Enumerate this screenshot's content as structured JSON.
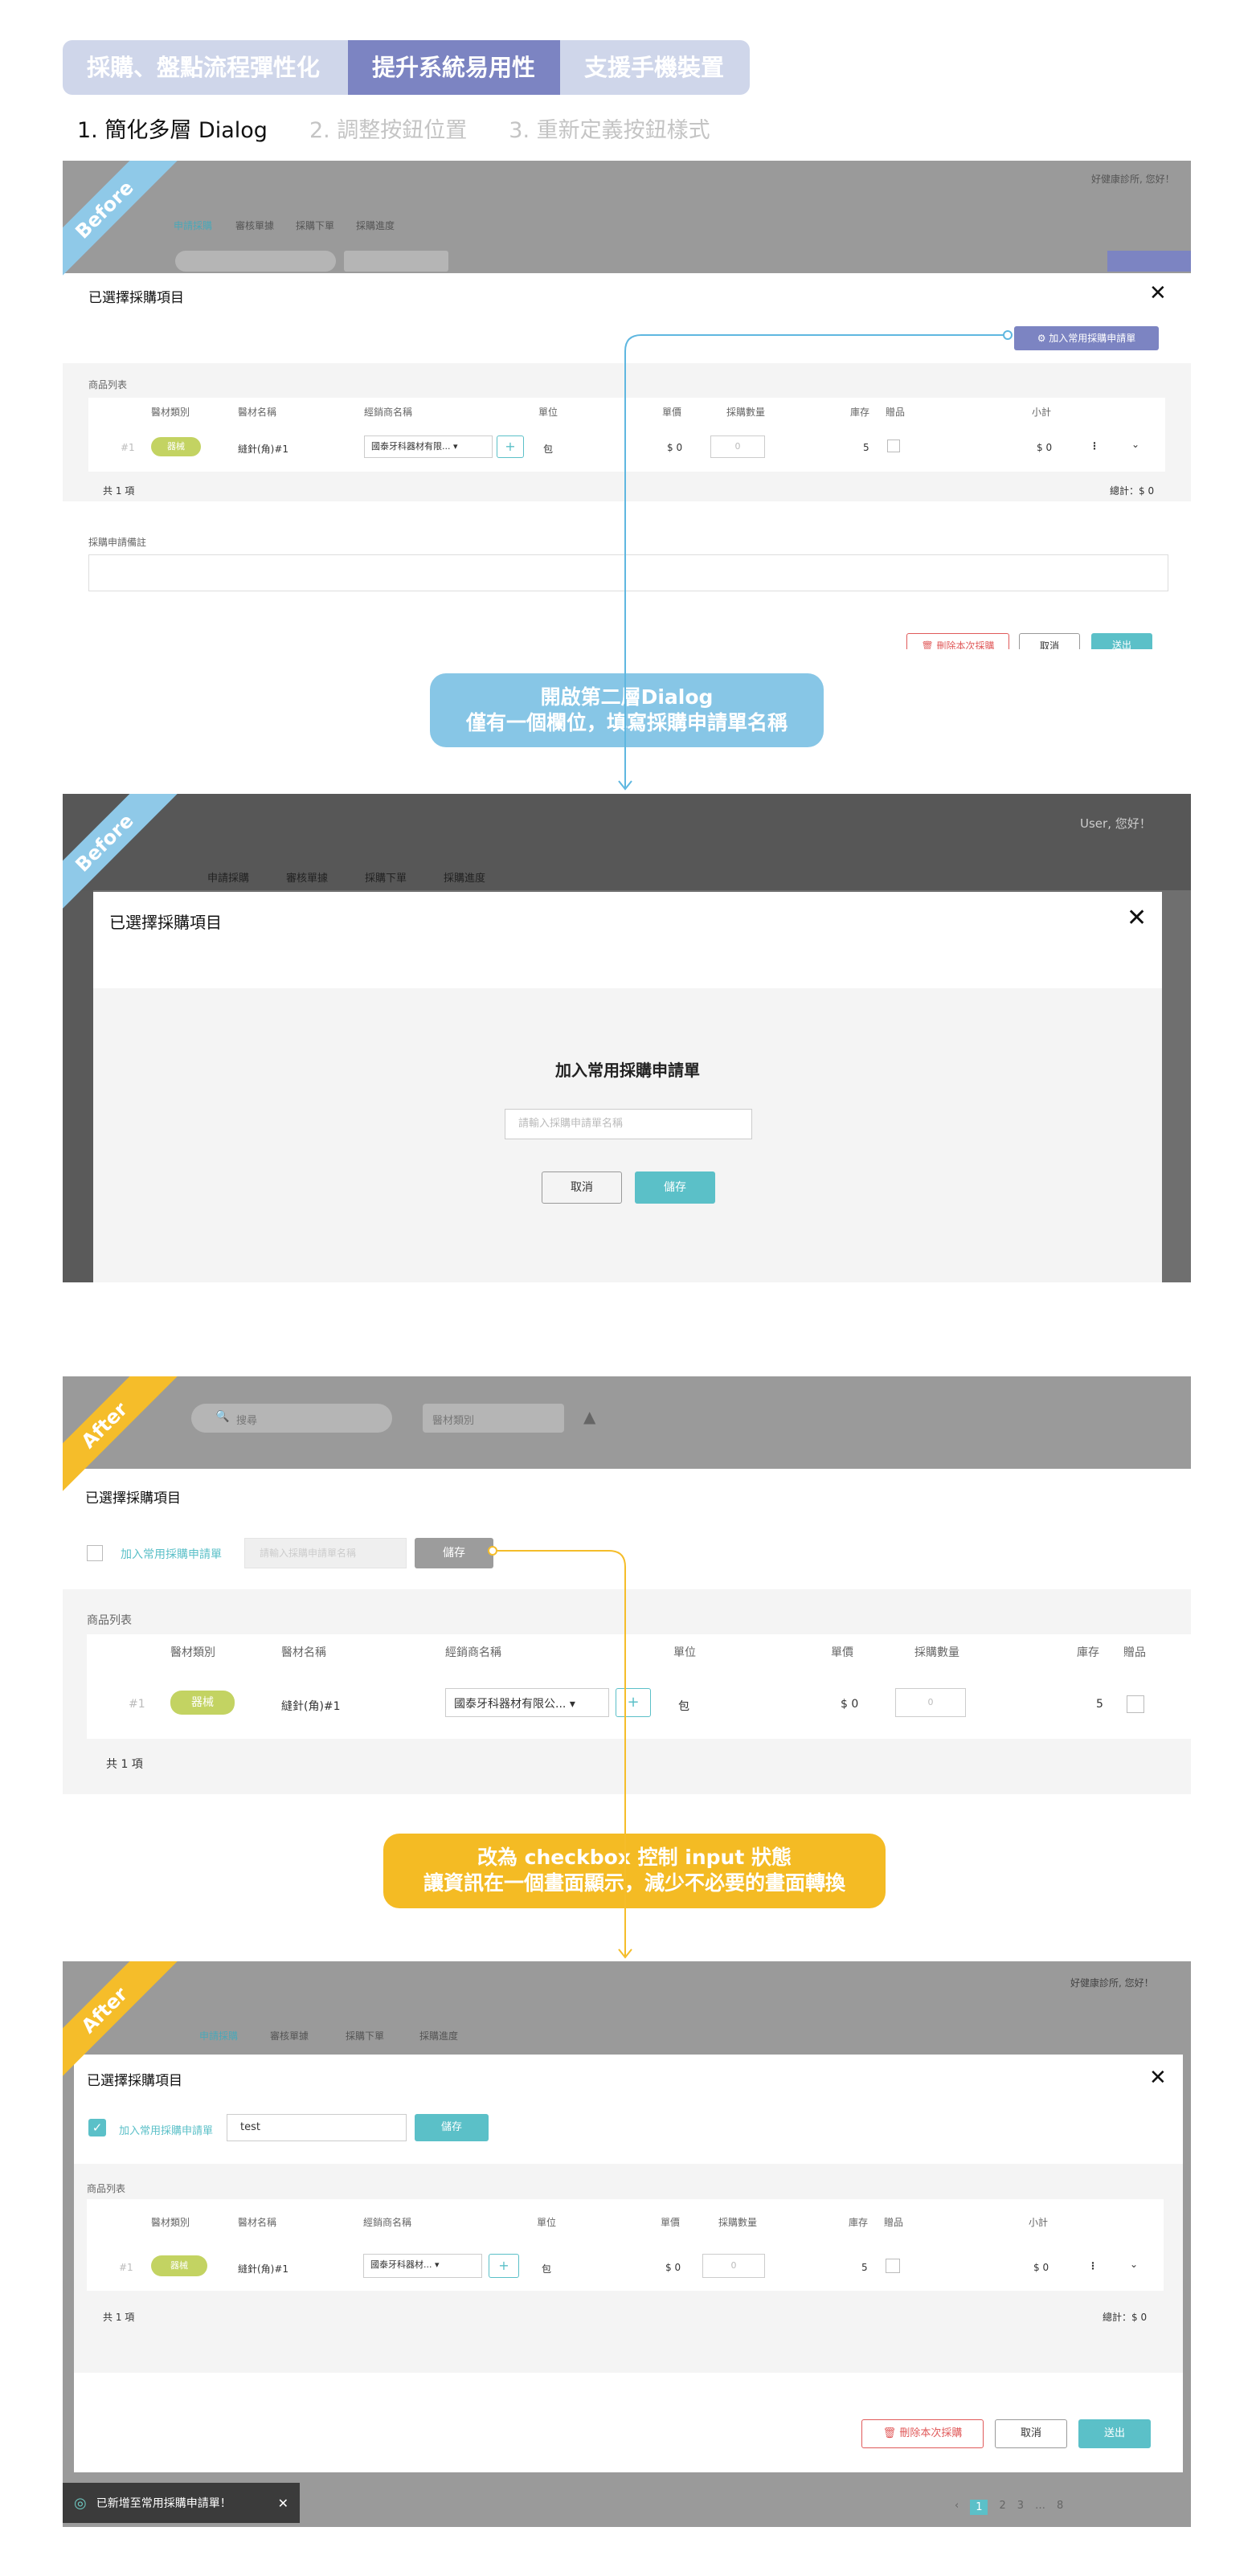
{
  "tabs": [
    {
      "label": "採購、盤點流程彈性化"
    },
    {
      "label": "提升系統易用性"
    },
    {
      "label": "支援手機裝置"
    }
  ],
  "steps": [
    {
      "label": "1. 簡化多層 Dialog"
    },
    {
      "label": "2. 調整按鈕位置"
    },
    {
      "label": "3. 重新定義按鈕樣式"
    }
  ],
  "badges": {
    "before": "Before",
    "after": "After"
  },
  "common": {
    "dialog_title": "已選擇採購項目",
    "add_common_btn": "加入常用採購申請單",
    "product_list": "商品列表",
    "headers": [
      "醫材類別",
      "醫材名稱",
      "經銷商名稱",
      "單位",
      "單價",
      "採購數量",
      "庫存",
      "贈品",
      "小計"
    ],
    "row": {
      "index": "#1",
      "category": "器械",
      "name": "縫針(角)#1",
      "dealer_short": "國泰牙科器材有限...",
      "dealer_long": "國泰牙科器材有限公...",
      "dealer_mid": "國泰牙科器材...",
      "unit": "包",
      "price": "$ 0",
      "qty_placeholder": "0",
      "stock": "5",
      "subtotal": "$ 0"
    },
    "count": "共 1 項",
    "total": "總計：$ 0",
    "note_label": "採購申請備註",
    "delete_btn": "刪除本次採購",
    "cancel_btn": "取消",
    "submit_btn": "送出",
    "greeting": "好健康診所, 您好！",
    "greeting2": "User, 您好！",
    "nav": [
      "申請採購",
      "審核單據",
      "採購下單",
      "採購進度"
    ],
    "search_placeholder": "搜尋",
    "category_filter": "醫材類別"
  },
  "shot2": {
    "subdialog_title": "加入常用採購申請單",
    "input_placeholder": "請輸入採購申請單名稱",
    "cancel": "取消",
    "save": "儲存"
  },
  "shot3": {
    "checkbox_label": "加入常用採購申請單",
    "input_placeholder": "請輸入採購申請單名稱",
    "save": "儲存"
  },
  "shot4": {
    "checkbox_label": "加入常用採購申請單",
    "input_value": "test",
    "save": "儲存",
    "toast": "已新增至常用採購申請單！",
    "pages": [
      "1",
      "2",
      "3",
      "…",
      "8"
    ]
  },
  "callouts": {
    "blue": [
      "開啟第二層Dialog",
      "僅有一個欄位，填寫採購申請單名稱"
    ],
    "gold": [
      "改為 checkbox 控制 input 狀態",
      "讓資訊在一個畫面顯示，減少不必要的畫面轉換"
    ]
  },
  "colors": {
    "accent": "#5bc0c8",
    "primary": "#7c84c2",
    "tab_inactive": "#cfd6ea",
    "callout_blue": "#87c6e6",
    "callout_gold": "#f4bb24",
    "tag": "#c3d362",
    "danger": "#e05a5a"
  }
}
